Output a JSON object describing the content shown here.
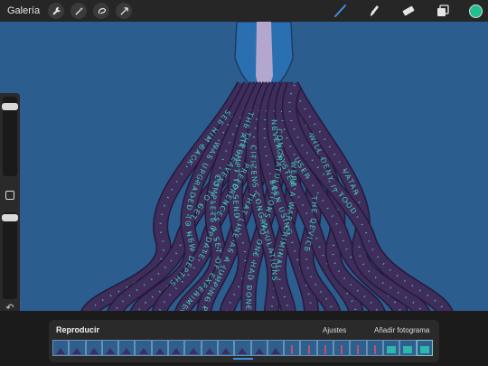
{
  "topbar": {
    "gallery_label": "Galería",
    "tools_left": [
      "wrench-icon",
      "magic-wand-icon",
      "selection-icon",
      "transform-icon"
    ],
    "tools_right": [
      "brush-icon",
      "smudge-icon",
      "eraser-icon",
      "layers-icon"
    ],
    "color_swatch": "#1fbf8f"
  },
  "canvas": {
    "background": "#2b5d8e",
    "text_color": "#42c9b6",
    "tentacle_color": "#3f2d5c",
    "phrases": [
      "SEE HIM BACK",
      "THE HEAVENS TO GET",
      "WAS UPGRADED TO NEW DEPTHS",
      "PREFERENCES UPDATE",
      "COMPLETE A SET OF EXPERIMENTS",
      "THAT LINE AS A JUMPING POINT",
      "THE ATTEMPT TO SEND",
      "CONGRATULATIONS NO ONE HAD DONE THAT BEFORE",
      "CITIZENS CONGRATULATIONS",
      "WERE A WAR CRIMINAL",
      "BEEN USING",
      "THE DEVICE",
      "NEVER SYSTEM",
      "WILL DENY IT",
      "USER",
      "VATAR",
      "TOOD"
    ]
  },
  "timeline": {
    "play_label": "Reproducir",
    "settings_label": "Ajustes",
    "add_frame_label": "Añadir fotograma",
    "frame_count": 23
  }
}
